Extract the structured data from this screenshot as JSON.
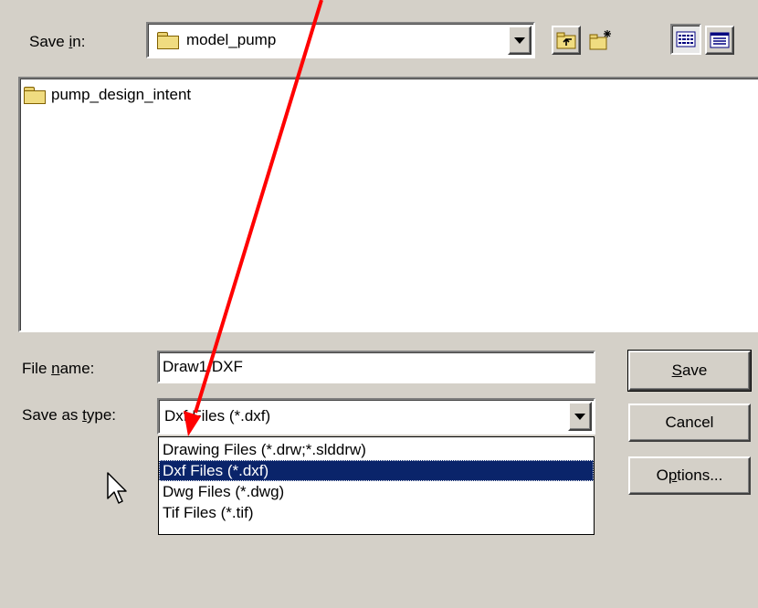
{
  "save_in": {
    "label_prefix": "Save ",
    "label_access": "i",
    "label_suffix": "n:",
    "value": "model_pump"
  },
  "file_list": {
    "items": [
      {
        "name": "pump_design_intent",
        "icon": "folder-icon"
      }
    ]
  },
  "file_name": {
    "label_prefix": "File ",
    "label_access": "n",
    "label_suffix": "ame:",
    "value": "Draw1.DXF"
  },
  "save_as_type": {
    "label_prefix": "Save as ",
    "label_access": "t",
    "label_suffix": "ype:",
    "value": "Dxf Files (*.dxf)",
    "options": [
      "Drawing Files (*.drw;*.slddrw)",
      "Dxf Files (*.dxf)",
      "Dwg Files (*.dwg)",
      "Tif Files (*.tif)"
    ],
    "selected_index": 1
  },
  "buttons": {
    "save_access": "S",
    "save_rest": "ave",
    "cancel": "Cancel",
    "options_prefix": "O",
    "options_access": "p",
    "options_rest": "tions..."
  },
  "colors": {
    "annotation_arrow": "#ff0000",
    "selection": "#0a246a"
  }
}
